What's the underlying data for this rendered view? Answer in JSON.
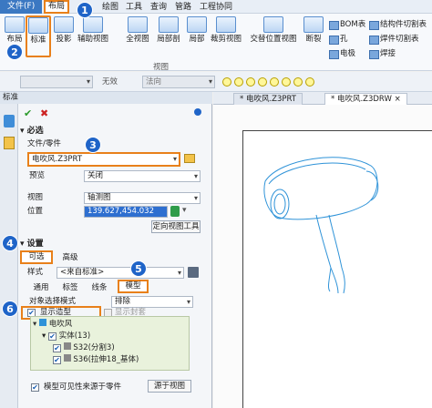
{
  "menubar": {
    "file": "文件(F)",
    "layout": "布局",
    "items": [
      "绘图",
      "工具",
      "查询",
      "管路",
      "工程协同"
    ]
  },
  "ribbon": {
    "buttons": [
      "布局",
      "标准",
      "投影",
      "辅助视图",
      "全视图",
      "局部剖",
      "局部",
      "裁剪视图",
      "交替位置视图",
      "断裂"
    ],
    "small": [
      "BOM表",
      "结构件切割表",
      "孔",
      "焊件切割表",
      "电极",
      "焊接"
    ],
    "group_label": "视图"
  },
  "toolbar": {
    "filter_all": "",
    "invalid": "无效",
    "normal": "法向"
  },
  "panel": {
    "title": "标准",
    "required": "必选",
    "file_part_label": "文件/零件",
    "file_part_value": "电吹风.Z3PRT",
    "preview_label": "预览",
    "preview_value": "关闭",
    "view_label": "视图",
    "view_value": "轴测图",
    "position_label": "位置",
    "position_value": "139.627,454.032",
    "orient_button": "定向视图工具",
    "settings": "设置",
    "tab_optional": "可选",
    "tab_advanced": "高级",
    "style_label": "样式",
    "style_value": "<来自标准>",
    "subtabs": [
      "通用",
      "标签",
      "线条",
      "模型"
    ],
    "select_mode_label": "对象选择模式",
    "select_mode_value": "排除",
    "show_model": "显示造型",
    "show_closure": "显示封套",
    "tree": {
      "root": "电吹风",
      "solid": "实体(13)",
      "s32": "S32(分割3)",
      "s36": "S36(拉伸18_基体)"
    },
    "visible_from_part": "模型可见性来源于零件",
    "from_view_button": "源于视图"
  },
  "doc_tabs": [
    "电吹风.Z3PRT",
    "电吹风.Z3DRW"
  ],
  "callouts": [
    "1",
    "2",
    "3",
    "4",
    "5",
    "6"
  ],
  "colors": {
    "accent": "#1f64c8",
    "highlight": "#e8801a",
    "position_bg": "#2e6fd0",
    "drawing_line": "#2f93d8"
  }
}
